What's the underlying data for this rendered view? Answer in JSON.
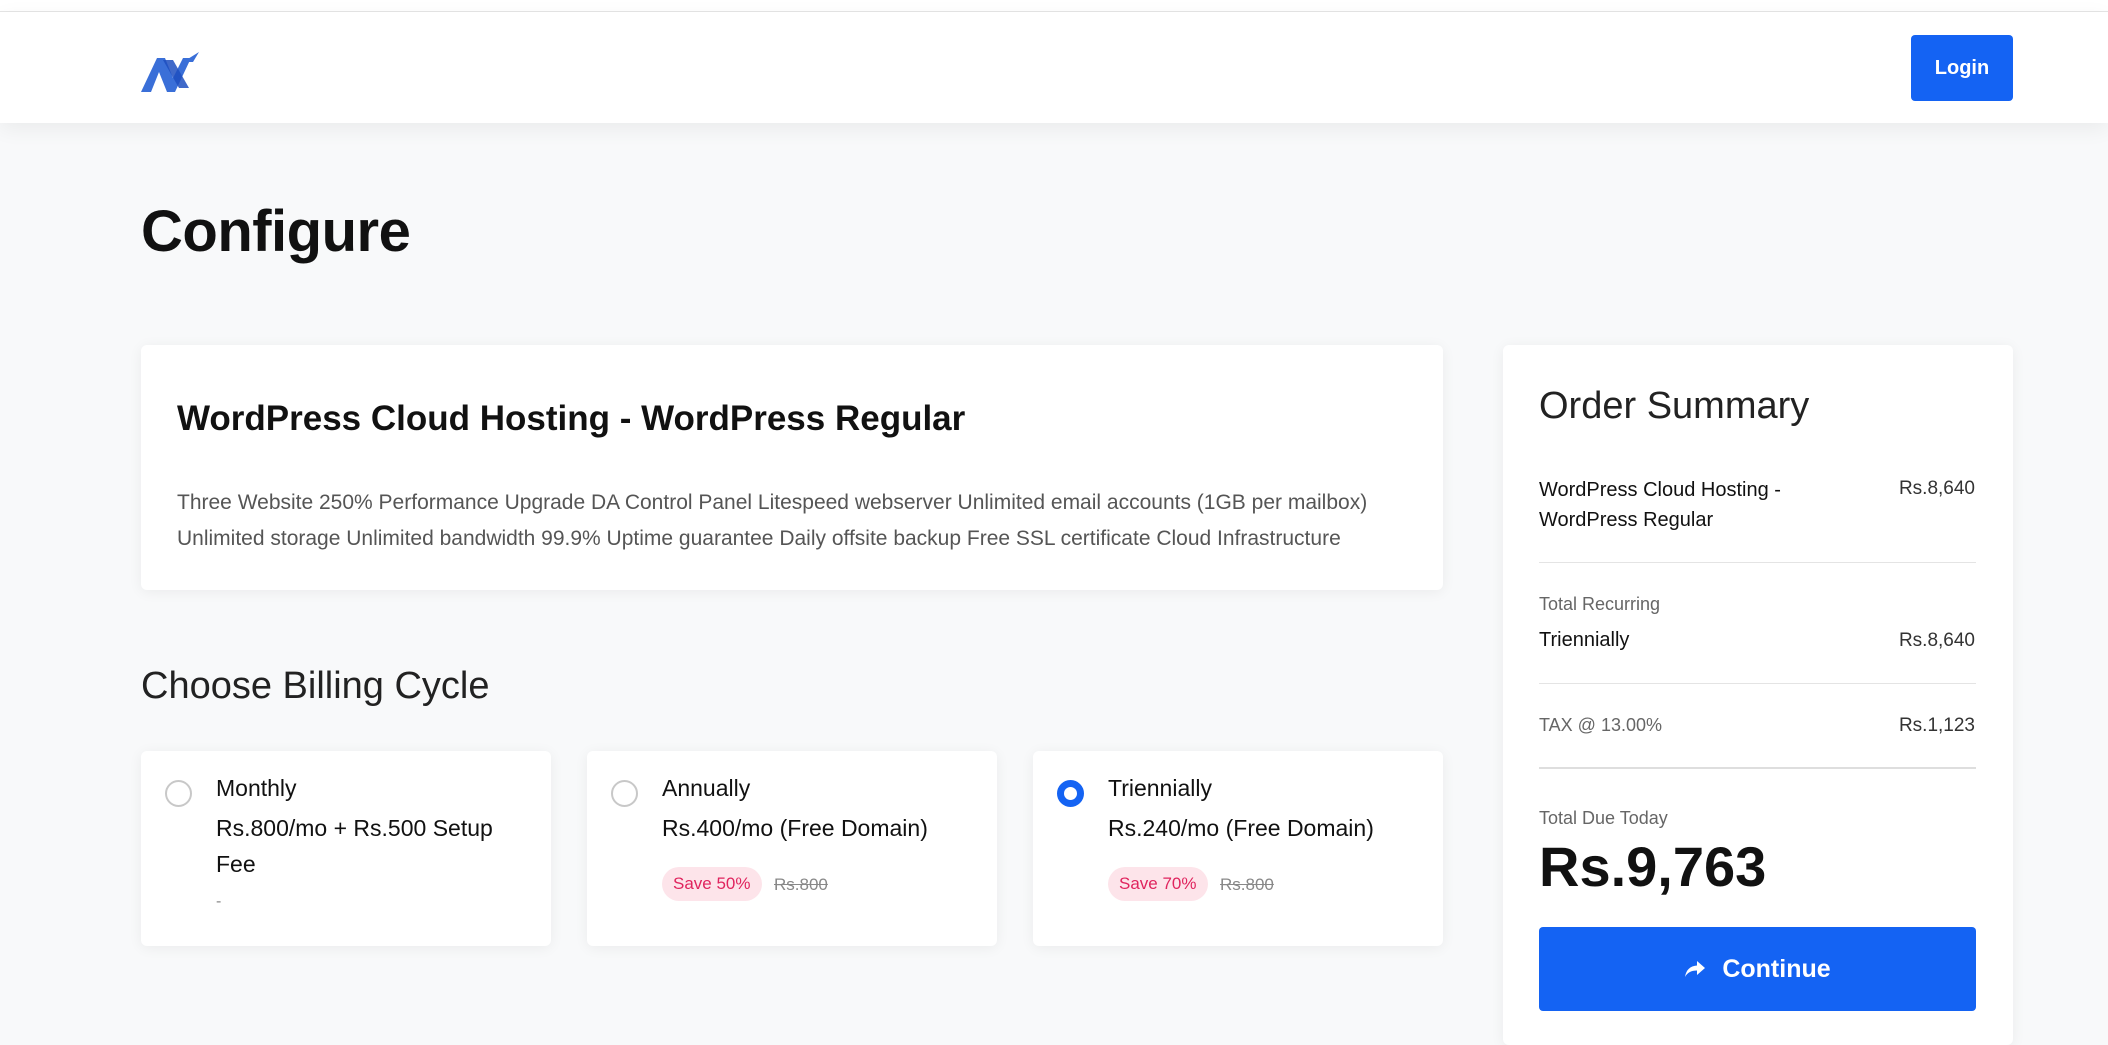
{
  "header": {
    "logo_icon": "brand-logo-icon",
    "login_label": "Login",
    "accent_color": "#1463f3"
  },
  "page": {
    "title": "Configure"
  },
  "product": {
    "name": "WordPress Cloud Hosting - WordPress Regular",
    "description": "Three Website 250% Performance Upgrade DA Control Panel Litespeed webserver Unlimited email accounts (1GB per mailbox) Unlimited storage Unlimited bandwidth 99.9% Uptime guarantee Daily offsite backup Free SSL certificate Cloud Infrastructure"
  },
  "billing": {
    "title": "Choose Billing Cycle",
    "options": [
      {
        "name": "Monthly",
        "price": "Rs.800/mo + Rs.500 Setup Fee",
        "note": "-",
        "selected": false
      },
      {
        "name": "Annually",
        "price": "Rs.400/mo (Free Domain)",
        "save": "Save 50%",
        "old_price": "Rs.800",
        "selected": false
      },
      {
        "name": "Triennially",
        "price": "Rs.240/mo (Free Domain)",
        "save": "Save 70%",
        "old_price": "Rs.800",
        "selected": true
      }
    ]
  },
  "summary": {
    "title": "Order Summary",
    "product_name": "WordPress Cloud Hosting - WordPress Regular",
    "product_price": "Rs.8,640",
    "recurring_label": "Total Recurring",
    "recurring_cycle": "Triennially",
    "recurring_price": "Rs.8,640",
    "tax_label": "TAX @ 13.00%",
    "tax_price": "Rs.1,123",
    "total_label": "Total Due Today",
    "total_amount": "Rs.9,763",
    "continue_label": "Continue",
    "continue_icon": "share-arrow-icon"
  }
}
